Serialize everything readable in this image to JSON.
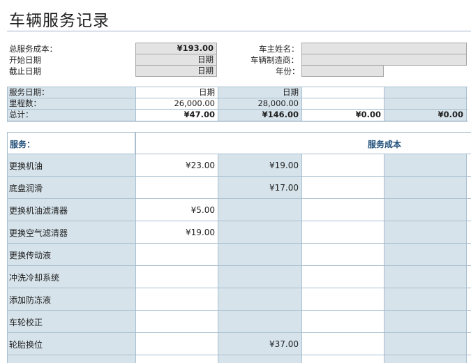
{
  "title": "车辆服务记录",
  "summary": {
    "total_cost_label": "总服务成本：",
    "total_cost_value": "¥193.00",
    "start_date_label": "开始日期",
    "start_date_value": "日期",
    "end_date_label": "截止日期",
    "end_date_value": "日期",
    "owner_label": "车主姓名：",
    "owner_value": "",
    "maker_label": "车辆制造商：",
    "maker_value": "",
    "year_label": "年份：",
    "year_value": ""
  },
  "visit_table": {
    "row_labels": [
      "服务日期：",
      "里程数：",
      "总计："
    ],
    "columns": [
      {
        "date": "日期",
        "mileage": "26,000.00",
        "total": "¥47.00"
      },
      {
        "date": "日期",
        "mileage": "28,000.00",
        "total": "¥146.00"
      },
      {
        "date": "",
        "mileage": "",
        "total": "¥0.00"
      },
      {
        "date": "",
        "mileage": "",
        "total": "¥0.00"
      }
    ]
  },
  "service_table": {
    "header_service": "服务：",
    "header_cost": "服务成本",
    "rows": [
      {
        "name": "更换机油",
        "values": [
          "¥23.00",
          "¥19.00",
          "",
          ""
        ]
      },
      {
        "name": "底盘润滑",
        "values": [
          "",
          "¥17.00",
          "",
          ""
        ]
      },
      {
        "name": "更换机油滤清器",
        "values": [
          "¥5.00",
          "",
          "",
          ""
        ]
      },
      {
        "name": "更换空气滤清器",
        "values": [
          "¥19.00",
          "",
          "",
          ""
        ]
      },
      {
        "name": "更换传动液",
        "values": [
          "",
          "",
          "",
          ""
        ]
      },
      {
        "name": "冲洗冷却系统",
        "values": [
          "",
          "",
          "",
          ""
        ]
      },
      {
        "name": "添加防冻液",
        "values": [
          "",
          "",
          "",
          ""
        ]
      },
      {
        "name": "车轮校正",
        "values": [
          "",
          "",
          "",
          ""
        ]
      },
      {
        "name": "轮胎换位",
        "values": [
          "",
          "¥37.00",
          "",
          ""
        ]
      }
    ]
  },
  "colors": {
    "shade": "#d6e3eb",
    "grid": "#a9bfd0",
    "header_text": "#1f4e79",
    "input_fill": "#e3e3e3"
  }
}
